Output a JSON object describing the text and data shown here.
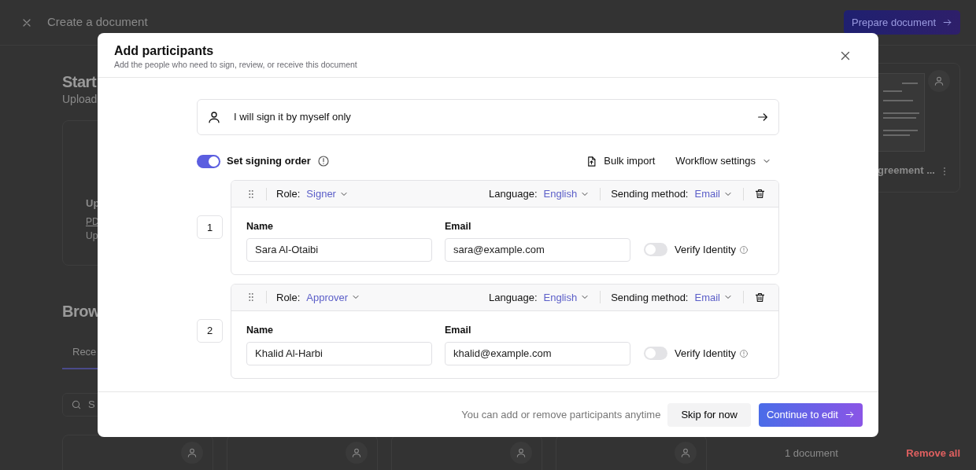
{
  "page": {
    "title": "Create a document",
    "primary_button": "Prepare document",
    "heading": "Start",
    "subheading": "Upload",
    "upload_card": {
      "title": "Up",
      "link": "PD",
      "note": "Up"
    },
    "recent_document": {
      "title": "greement ..."
    },
    "section_heading": "Brow",
    "tabs": [
      {
        "label": "Rece",
        "selected": true
      }
    ],
    "search": {
      "placeholder": "S"
    },
    "document_count": "1 document",
    "remove_all": "Remove all"
  },
  "modal": {
    "title": "Add participants",
    "subtitle": "Add the people who need to sign, review, or receive this document",
    "self_sign_option": "I will sign it by myself only",
    "signing_order": {
      "label": "Set signing order",
      "on": true
    },
    "actions": [
      {
        "label": "Bulk import",
        "kind": "import"
      },
      {
        "label": "Workflow settings",
        "kind": "dropdown"
      }
    ],
    "participants": [
      {
        "number": "1",
        "role_label": "Role:",
        "role": "Signer",
        "language_label": "Language:",
        "language": "English",
        "method_label": "Sending method:",
        "method": "Email",
        "name_label": "Name",
        "name": "Sara Al-Otaibi",
        "email_label": "Email",
        "email": "sara@example.com",
        "verify_label": "Verify Identity",
        "verify_on": false
      },
      {
        "number": "2",
        "role_label": "Role:",
        "role": "Approver",
        "language_label": "Language:",
        "language": "English",
        "method_label": "Sending method:",
        "method": "Email",
        "name_label": "Name",
        "name": "Khalid Al-Harbi",
        "email_label": "Email",
        "email": "khalid@example.com",
        "verify_label": "Verify Identity",
        "verify_on": false
      }
    ],
    "footer": {
      "note": "You can add or remove participants anytime",
      "buttons": [
        {
          "label": "Skip for now",
          "kind": "secondary"
        },
        {
          "label": "Continue to edit",
          "kind": "primary"
        }
      ]
    }
  }
}
